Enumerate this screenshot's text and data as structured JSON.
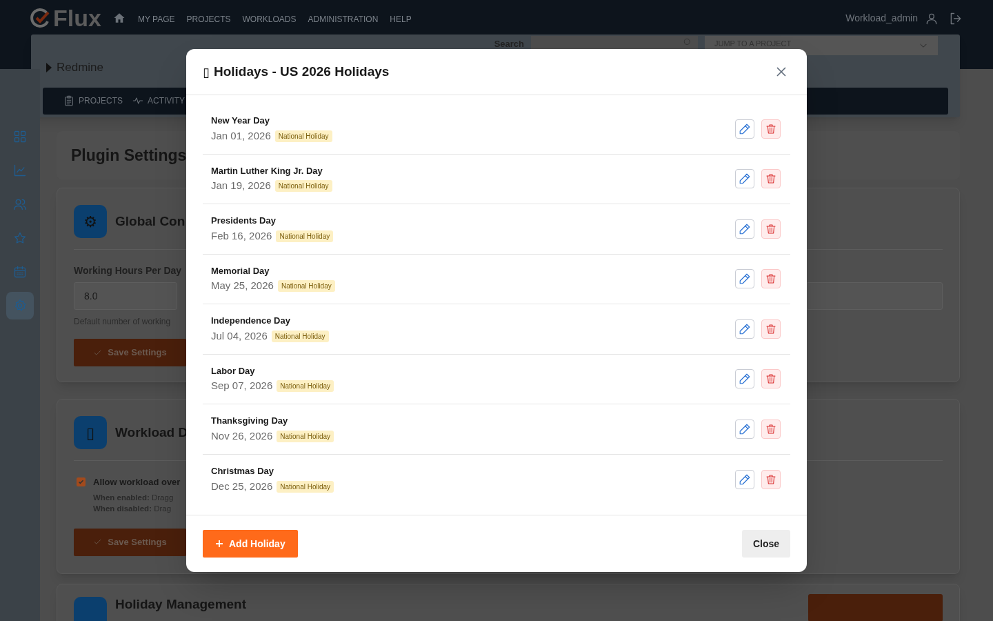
{
  "topbar": {
    "logo": "Flux",
    "nav": [
      "MY PAGE",
      "PROJECTS",
      "WORKLOADS",
      "ADMINISTRATION",
      "HELP"
    ],
    "user": "Workload_admin"
  },
  "project_header": {
    "title": "Redmine",
    "search_label": "Search",
    "jump_placeholder": "JUMP TO A PROJECT",
    "tabs": [
      "PROJECTS",
      "ACTIVITY"
    ]
  },
  "sidebar": {
    "items": [
      {
        "selected": false
      },
      {
        "selected": false
      },
      {
        "selected": false
      },
      {
        "selected": false
      },
      {
        "selected": false
      },
      {
        "selected": true
      }
    ]
  },
  "page_title": "Plugin Settings",
  "sections": [
    {
      "kind": "field",
      "icon": "⚙",
      "title": "Global Con",
      "field_label": "Working Hours Per Day",
      "field_value": "8.0",
      "help": "Default number of working",
      "button": "Save Settings"
    },
    {
      "kind": "checkbox",
      "icon": "▯",
      "title": "Workload D",
      "checkbox": {
        "label": "Allow workload over",
        "checked": true
      },
      "notes": [
        "**When enabled:** Dragg",
        "**When disabled:** Drag"
      ],
      "button": "Save Settings"
    },
    {
      "kind": "header",
      "title": "Holiday Management"
    }
  ],
  "modal": {
    "title_icon": "▯",
    "title": "Holidays - US 2026 Holidays",
    "holidays": [
      {
        "name": "New Year Day",
        "date": "Jan 01, 2026",
        "type": "National Holiday"
      },
      {
        "name": "Martin Luther King Jr. Day",
        "date": "Jan 19, 2026",
        "type": "National Holiday"
      },
      {
        "name": "Presidents Day",
        "date": "Feb 16, 2026",
        "type": "National Holiday"
      },
      {
        "name": "Memorial Day",
        "date": "May 25, 2026",
        "type": "National Holiday"
      },
      {
        "name": "Independence Day",
        "date": "Jul 04, 2026",
        "type": "National Holiday"
      },
      {
        "name": "Labor Day",
        "date": "Sep 07, 2026",
        "type": "National Holiday"
      },
      {
        "name": "Thanksgiving Day",
        "date": "Nov 26, 2026",
        "type": "National Holiday"
      },
      {
        "name": "Christmas Day",
        "date": "Dec 25, 2026",
        "type": "National Holiday"
      }
    ],
    "add_button": "Add Holiday",
    "close_button": "Close"
  }
}
